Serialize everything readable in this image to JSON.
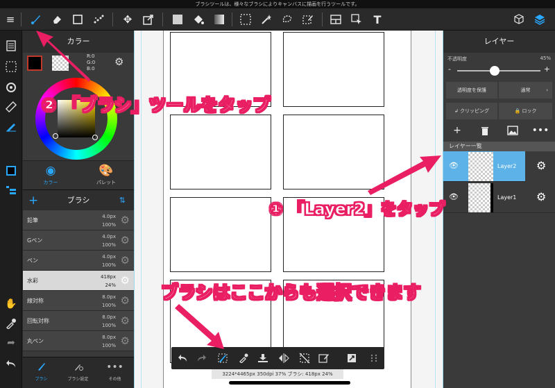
{
  "status_bar": {
    "text": "ブラシツールは、様々なブラシによりキャンバスに描画を行うツールです。"
  },
  "toolbar": {
    "tools": [
      "menu-icon",
      "brush-icon",
      "eraser-icon",
      "rectangle-icon",
      "dots-icon",
      "move-icon",
      "transform-icon",
      "fill-color-icon",
      "bucket-icon",
      "gradient-icon",
      "select-icon",
      "magic-wand-icon",
      "lasso-icon",
      "select-pen-icon",
      "panel-icon",
      "select-move-icon",
      "text-icon",
      "3d-icon",
      "layers-icon"
    ],
    "text_tool_label": "T"
  },
  "left_rail": {
    "icons": [
      "pages-icon",
      "selection-icon",
      "rotate-icon",
      "ruler-icon",
      "snap-icon",
      "color-layer-icon",
      "layer-list-icon",
      "hand-icon",
      "eyedropper-icon",
      "redo-icon",
      "undo-icon"
    ]
  },
  "color_panel": {
    "title": "カラー",
    "rgb": {
      "r": "R:0",
      "g": "G:0",
      "b": "B:0"
    },
    "tabs": [
      {
        "label": "カラー",
        "active": true
      },
      {
        "label": "パレット",
        "active": false
      }
    ]
  },
  "brush_panel": {
    "title": "ブラシ",
    "items": [
      {
        "name": "鉛筆",
        "size": "4.0px",
        "opacity": "100%",
        "selected": false
      },
      {
        "name": "Gペン",
        "size": "4.0px",
        "opacity": "100%",
        "selected": false
      },
      {
        "name": "ペン",
        "size": "4.0px",
        "opacity": "100%",
        "selected": false
      },
      {
        "name": "水彩",
        "size": "418px",
        "opacity": "24%",
        "selected": true
      },
      {
        "name": "線対称",
        "size": "8.0px",
        "opacity": "100%",
        "selected": false
      },
      {
        "name": "回転対称",
        "size": "8.0px",
        "opacity": "100%",
        "selected": false
      },
      {
        "name": "丸ペン",
        "size": "8.0px",
        "opacity": "100%",
        "selected": false
      }
    ],
    "bottom_tabs": [
      {
        "label": "ブラシ",
        "active": true
      },
      {
        "label": "ブラシ設定",
        "active": false
      },
      {
        "label": "その他",
        "active": false
      }
    ]
  },
  "canvas": {
    "info": "3224*4465px 350dpi 37% ブラシ: 418px 24%"
  },
  "layer_panel": {
    "title": "レイヤー",
    "opacity_label": "不透明度",
    "opacity_value": "45%",
    "opacity_fraction": 0.45,
    "protect_label": "透明度を保護",
    "blend_label": "通常",
    "clipping_label": "クリッピング",
    "lock_label": "ロック",
    "list_title": "レイヤー一覧",
    "layers": [
      {
        "name": "Layer2",
        "selected": true
      },
      {
        "name": "Layer1",
        "selected": false
      }
    ]
  },
  "annotations": {
    "step2": "② 「ブラシ」ツールをタップ",
    "step1": "① 「Layer2」をタップ",
    "note": "ブラシはここからも選択できます",
    "color": "#e91e63"
  }
}
